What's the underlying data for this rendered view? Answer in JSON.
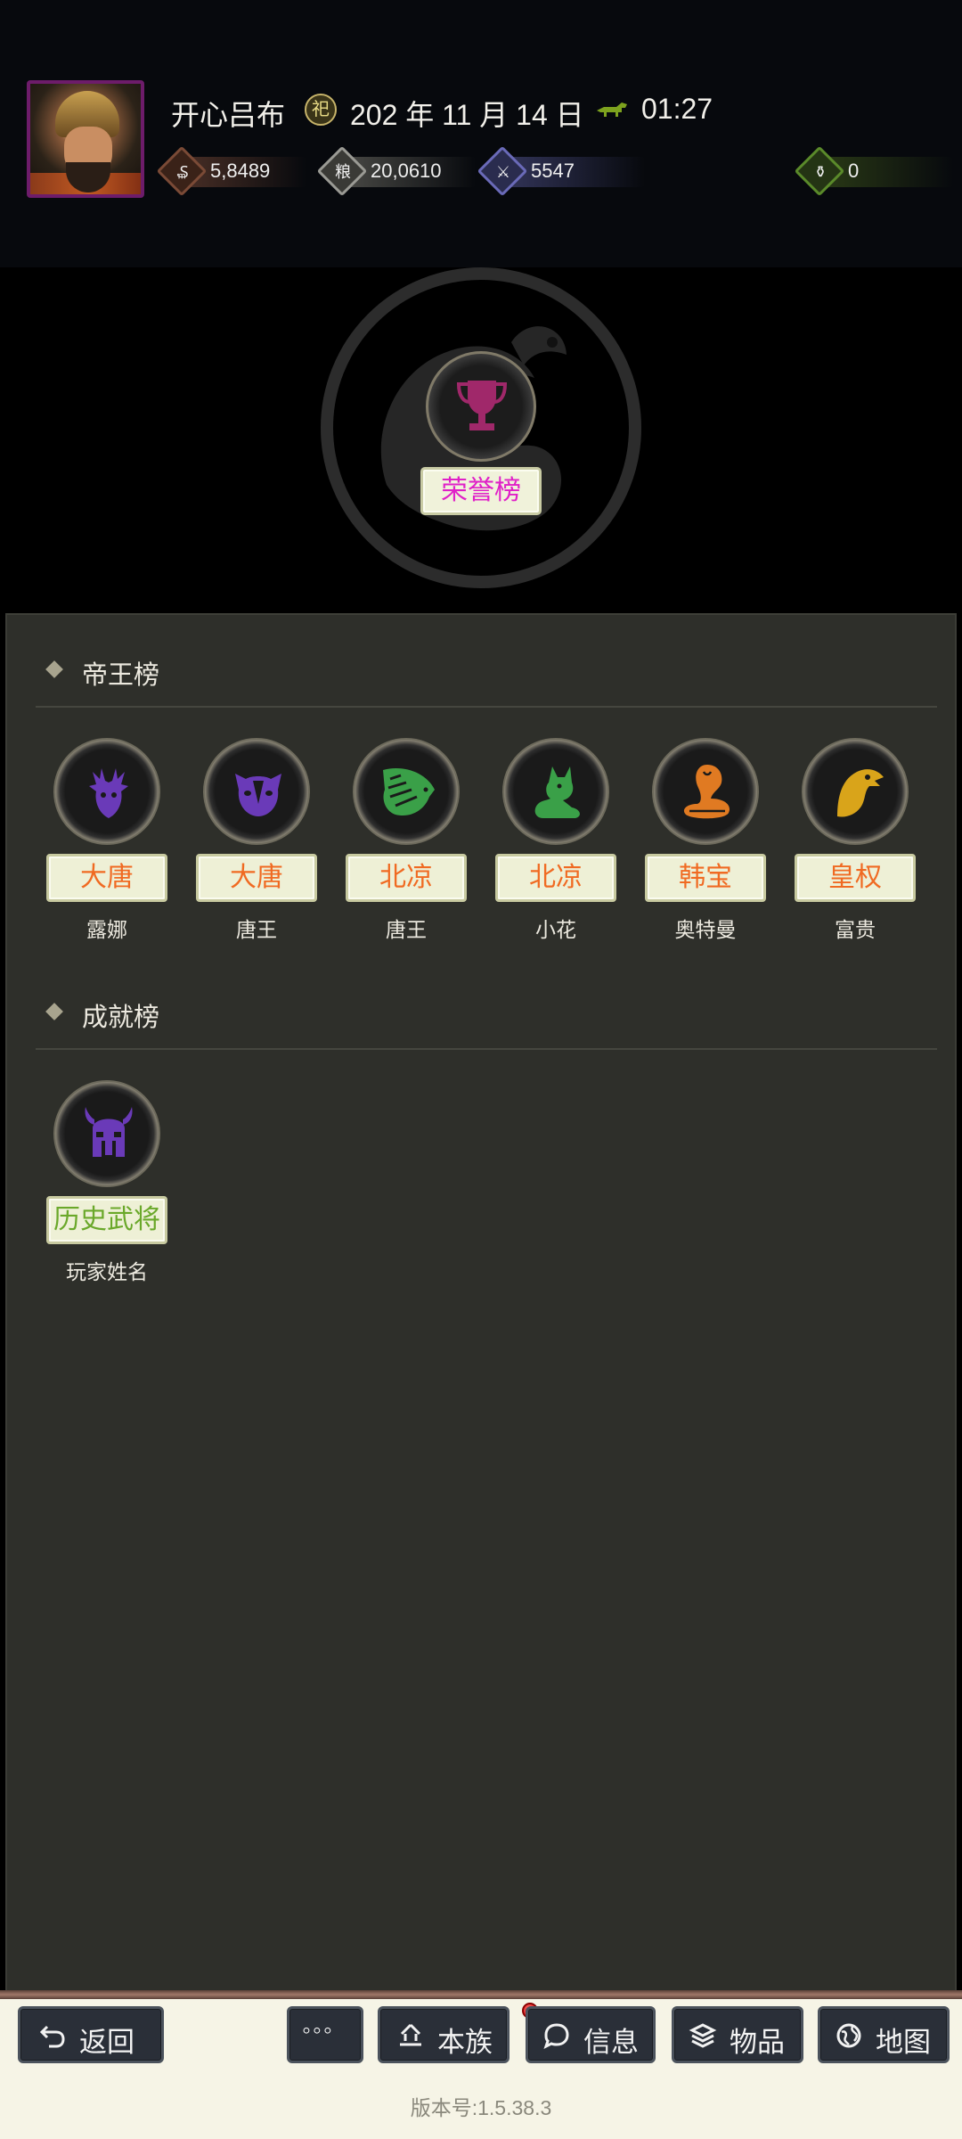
{
  "header": {
    "player_name": "开心吕布",
    "date_icon_glyph": "祀",
    "date": "202 年 11 月 14 日",
    "time": "01:27",
    "resources": [
      {
        "name": "money",
        "value": "5,8489",
        "glyph": "₷",
        "color": "#7a4a36",
        "bar": "#4a2f26"
      },
      {
        "name": "grain",
        "value": "20,0610",
        "glyph": "粮",
        "color": "#9a9a94",
        "bar": "#4a4a46"
      },
      {
        "name": "troops",
        "value": "5547",
        "glyph": "⚔",
        "color": "#6a6ab8",
        "bar": "#33355a"
      },
      {
        "name": "items",
        "value": "0",
        "glyph": "⚱",
        "color": "#5a8a2a",
        "bar": "#2a3a16"
      }
    ]
  },
  "honor": {
    "label": "荣誉榜"
  },
  "sections": {
    "emperor_title": "帝王榜",
    "achievement_title": "成就榜"
  },
  "emperor_slots": [
    {
      "icon": "deer-icon",
      "tag": "大唐",
      "tag_color": "#f06a22",
      "owner": "露娜",
      "icon_color": "#6a3ab8"
    },
    {
      "icon": "badger-icon",
      "tag": "大唐",
      "tag_color": "#f06a22",
      "owner": "唐王",
      "icon_color": "#6a3ab8"
    },
    {
      "icon": "pangolin-icon",
      "tag": "北凉",
      "tag_color": "#f06a22",
      "owner": "唐王",
      "icon_color": "#3aa048"
    },
    {
      "icon": "fox-icon",
      "tag": "北凉",
      "tag_color": "#f06a22",
      "owner": "小花",
      "icon_color": "#3aa048"
    },
    {
      "icon": "cobra-icon",
      "tag": "韩宝",
      "tag_color": "#f06a22",
      "owner": "奥特曼",
      "icon_color": "#e07a22"
    },
    {
      "icon": "eagle-icon",
      "tag": "皇权",
      "tag_color": "#f06a22",
      "owner": "富贵",
      "icon_color": "#d9a41a"
    }
  ],
  "achievement_slots": [
    {
      "icon": "viking-helmet-icon",
      "tag": "历史武将",
      "tag_color": "#6aa82a",
      "owner": "玩家姓名",
      "icon_color": "#6a3ab8"
    }
  ],
  "nav": {
    "back": "返回",
    "more": "◦◦◦",
    "clan": "本族",
    "info": "信息",
    "items": "物品",
    "map": "地图"
  },
  "version": "版本号:1.5.38.3"
}
